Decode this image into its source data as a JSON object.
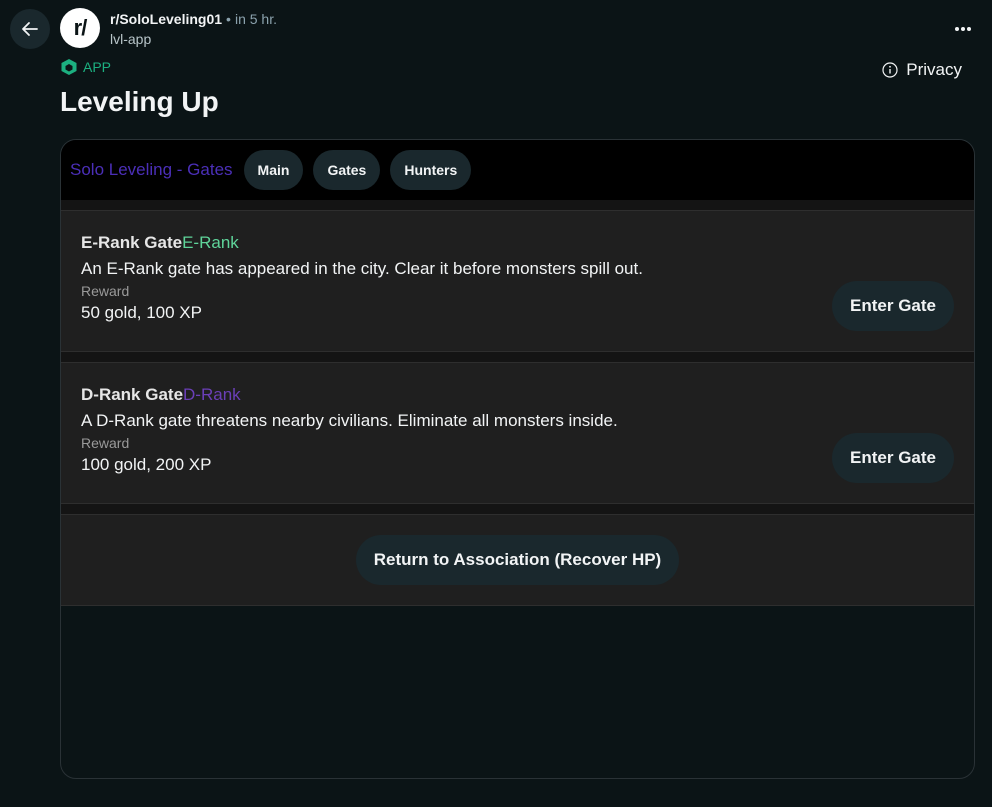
{
  "header": {
    "subreddit": "r/SoloLeveling01",
    "separator": "•",
    "time": "in 5 hr.",
    "username": "lvl-app",
    "avatar_text": "r/",
    "app_badge": "APP",
    "privacy_label": "Privacy"
  },
  "post": {
    "title": "Leveling Up"
  },
  "app": {
    "nav_title": "Solo Leveling - Gates",
    "nav_buttons": [
      "Main",
      "Gates",
      "Hunters"
    ],
    "gates": [
      {
        "name": "E-Rank Gate",
        "rank": "E-Rank",
        "description": "An E-Rank gate has appeared in the city. Clear it before monsters spill out.",
        "reward_label": "Reward",
        "reward": "50 gold, 100 XP",
        "button": "Enter Gate"
      },
      {
        "name": "D-Rank Gate",
        "rank": "D-Rank",
        "description": "A D-Rank gate threatens nearby civilians. Eliminate all monsters inside.",
        "reward_label": "Reward",
        "reward": "100 gold, 200 XP",
        "button": "Enter Gate"
      }
    ],
    "return_button": "Return to Association (Recover HP)"
  },
  "colors": {
    "background": "#0b1416",
    "button_bg": "#1a282d",
    "app_green": "#1cb080",
    "nav_title": "#4b2fb8",
    "e_rank": "#5fd49a",
    "d_rank": "#6b3fb8"
  },
  "icons": {
    "back": "arrow-left-icon",
    "more": "more-horizontal-icon",
    "app": "cube-icon",
    "privacy": "info-icon"
  }
}
